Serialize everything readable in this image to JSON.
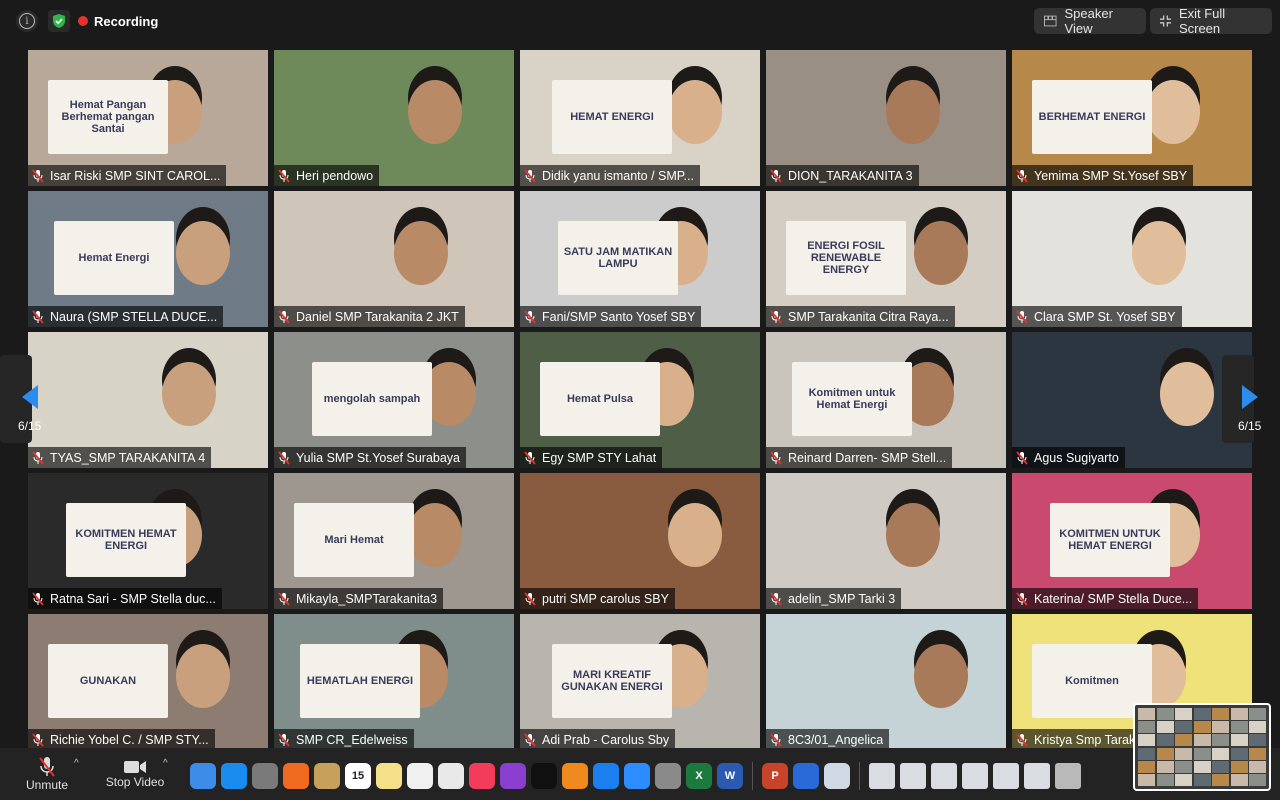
{
  "topbar": {
    "recording_label": "Recording",
    "speaker_view_label": "Speaker View",
    "exit_fullscreen_label": "Exit Full Screen"
  },
  "pagination": {
    "left_label": "6/15",
    "right_label": "6/15"
  },
  "participants": [
    {
      "name": "Isar Riski SMP SINT CAROL...",
      "bg": "#b8a899",
      "sign": "Hemat Pangan\nBerhemat pangan\nSantai"
    },
    {
      "name": "Heri pendowo",
      "bg": "#6e8a5a",
      "sign": ""
    },
    {
      "name": "Didik yanu ismanto / SMP...",
      "bg": "#d9d2c6",
      "sign": "HEMAT ENERGI"
    },
    {
      "name": "DION_TARAKANITA 3",
      "bg": "#9a8f84",
      "sign": ""
    },
    {
      "name": "Yemima SMP St.Yosef SBY",
      "bg": "#b6884a",
      "sign": "BERHEMAT ENERGI"
    },
    {
      "name": "Naura (SMP STELLA DUCE...",
      "bg": "#6f7b86",
      "sign": "Hemat Energi"
    },
    {
      "name": "Daniel  SMP Tarakanita 2 JKT",
      "bg": "#cfc6b9",
      "sign": ""
    },
    {
      "name": "Fani/SMP Santo Yosef SBY",
      "bg": "#cccccc",
      "sign": "SATU JAM MATIKAN LAMPU"
    },
    {
      "name": "SMP Tarakanita Citra Raya...",
      "bg": "#d3cdc4",
      "sign": "ENERGI FOSIL RENEWABLE ENERGY"
    },
    {
      "name": "Clara SMP St. Yosef SBY",
      "bg": "#e4e2dc",
      "sign": ""
    },
    {
      "name": "TYAS_SMP TARAKANITA 4",
      "bg": "#d8d3c7",
      "sign": ""
    },
    {
      "name": "Yulia SMP St.Yosef Surabaya",
      "bg": "#8c8f8a",
      "sign": "mengolah sampah"
    },
    {
      "name": "Egy SMP STY Lahat",
      "bg": "#4f5e47",
      "sign": "Hemat Pulsa"
    },
    {
      "name": "Reinard Darren- SMP Stell...",
      "bg": "#c9c4bc",
      "sign": "Komitmen untuk Hemat Energi"
    },
    {
      "name": "Agus Sugiyarto",
      "bg": "#2c3640",
      "sign": ""
    },
    {
      "name": "Ratna Sari - SMP Stella duc...",
      "bg": "#2a2a2a",
      "sign": "KOMITMEN HEMAT ENERGI"
    },
    {
      "name": "Mikayla_SMPTarakanita3",
      "bg": "#9d9790",
      "sign": "Mari Hemat"
    },
    {
      "name": "putri SMP carolus SBY",
      "bg": "#8a5c3f",
      "sign": ""
    },
    {
      "name": "adelin_SMP Tarki 3",
      "bg": "#cfcac3",
      "sign": ""
    },
    {
      "name": "Katerina/ SMP Stella Duce...",
      "bg": "#c94a6e",
      "sign": "KOMITMEN UNTUK HEMAT ENERGI"
    },
    {
      "name": "Richie Yobel C. / SMP STY...",
      "bg": "#8d7c72",
      "sign": "GUNAKAN"
    },
    {
      "name": "SMP CR_Edelweiss",
      "bg": "#7f8e8a",
      "sign": "HEMATLAH ENERGI"
    },
    {
      "name": "Adi Prab - Carolus Sby",
      "bg": "#b8b4ae",
      "sign": "MARI KREATIF GUNAKAN ENERGI"
    },
    {
      "name": "8C3/01_Angelica",
      "bg": "#c6d3d6",
      "sign": ""
    },
    {
      "name": "Kristya Smp Tarakanita 3",
      "bg": "#efe27a",
      "sign": "Komitmen"
    }
  ],
  "controls": {
    "unmute_label": "Unmute",
    "stop_video_label": "Stop Video"
  },
  "dock_icons": [
    "finder-icon",
    "safari-icon",
    "launchpad-icon",
    "firefox-icon",
    "contacts-icon",
    "calendar-icon",
    "notes-icon",
    "reminders-icon",
    "photos-icon",
    "music-icon",
    "podcasts-icon",
    "tv-icon",
    "books-icon",
    "app-store-icon",
    "zoom-icon",
    "system-preferences-icon",
    "excel-icon",
    "word-icon",
    "powerpoint-icon",
    "browser-icon",
    "preview-icon"
  ],
  "calendar_date": "15"
}
